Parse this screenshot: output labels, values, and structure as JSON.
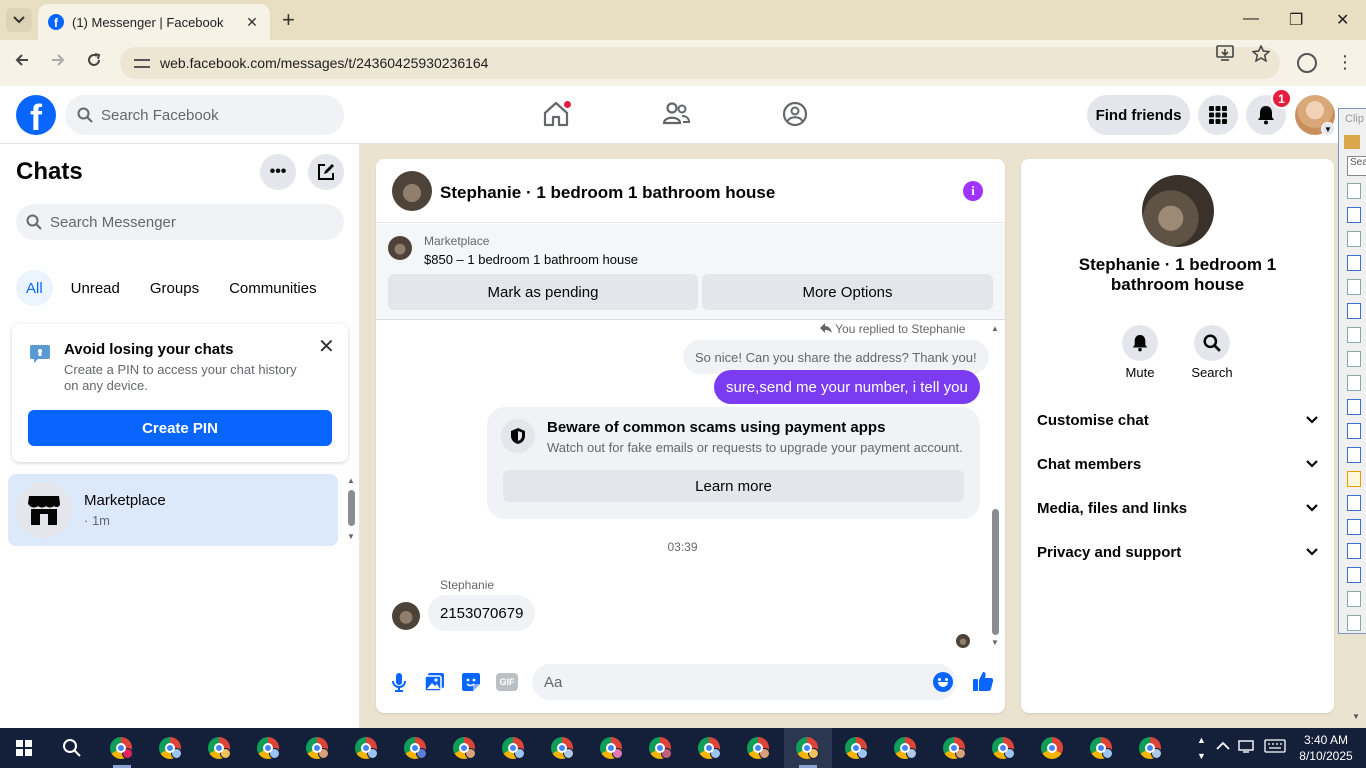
{
  "browser": {
    "tab_title": "(1) Messenger | Facebook",
    "url": "web.facebook.com/messages/t/24360425930236164",
    "close_tab": "✕",
    "new_tab": "+",
    "win_min": "—",
    "win_max": "❐",
    "win_close": "✕"
  },
  "header": {
    "search_placeholder": "Search Facebook",
    "find_friends": "Find friends",
    "notification_count": "1"
  },
  "left": {
    "title": "Chats",
    "search_placeholder": "Search Messenger",
    "filters": [
      "All",
      "Unread",
      "Groups",
      "Communities"
    ],
    "pin_card": {
      "title": "Avoid losing your chats",
      "text": "Create a PIN to access your chat history on any device.",
      "button": "Create PIN"
    },
    "chats": [
      {
        "name": "Marketplace",
        "time": "· 1m"
      }
    ]
  },
  "conversation": {
    "title": "Stephanie · 1 bedroom 1 bathroom house",
    "marketplace_label": "Marketplace",
    "listing": "$850 – 1 bedroom 1 bathroom house",
    "mark_pending": "Mark as pending",
    "more_options": "More Options",
    "replied_note": "You replied to Stephanie",
    "quoted_message": "So nice! Can you share the address? Thank you!",
    "outgoing_message": "sure,send me your number, i tell you",
    "scam_warning": {
      "title": "Beware of common scams using payment apps",
      "text": "Watch out for fake emails or requests to upgrade your payment account.",
      "button": "Learn more"
    },
    "timestamp": "03:39",
    "sender": "Stephanie",
    "incoming_message": "2153070679",
    "composer_placeholder": "Aa",
    "gif_label": "GIF"
  },
  "details": {
    "name": "Stephanie · 1 bedroom 1 bathroom house",
    "actions": [
      "Mute",
      "Search"
    ],
    "sections": [
      "Customise chat",
      "Chat members",
      "Media, files and links",
      "Privacy and support"
    ]
  },
  "sidestrip": {
    "clip_label": "Clip",
    "search_label": "Sea"
  },
  "taskbar": {
    "time": "3:40 AM",
    "date": "8/10/2025"
  },
  "colors": {
    "facebook_blue": "#0866ff",
    "outgoing_bubble": "#7b3bf0",
    "info_purple": "#a033ff",
    "badge_red": "#e41e3f"
  }
}
